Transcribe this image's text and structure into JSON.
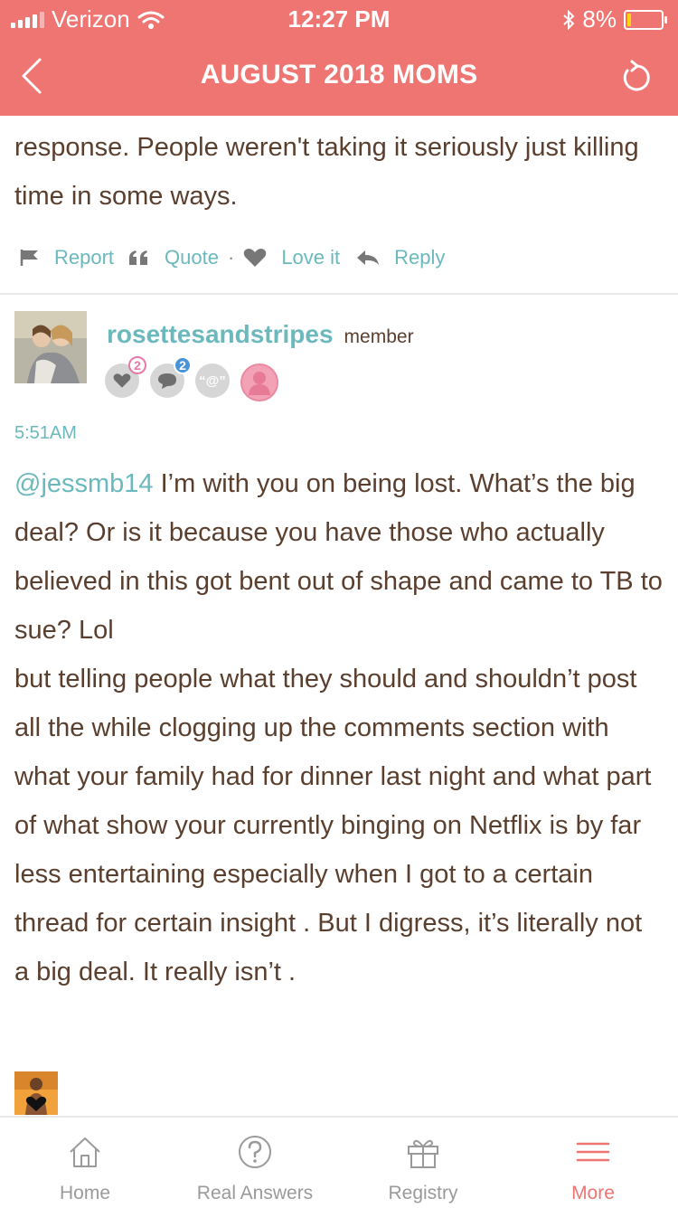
{
  "status_bar": {
    "carrier": "Verizon",
    "time": "12:27 PM",
    "battery": "8%"
  },
  "header": {
    "title": "AUGUST 2018 MOMS"
  },
  "previous_post": {
    "text": "response. People weren't taking it seriously just killing time in some ways.",
    "actions": {
      "report": "Report",
      "quote": "Quote",
      "separator": "·",
      "love": "Love it",
      "reply": "Reply"
    }
  },
  "post": {
    "username": "rosettesandstripes",
    "role": "member",
    "badges": {
      "hearts_count": "2",
      "comments_count": "2",
      "at_label": "“@”"
    },
    "time": "5:51AM",
    "mention": "@jessmb14",
    "body": " I’m with you on being lost. What’s the big deal? Or is it because you have those who actually believed in this got bent out of shape and came to TB to sue? Lol",
    "body2": "but telling people what they should and shouldn’t post all the while clogging up the comments section with what your family had for dinner last night and what part of what show your currently binging on Netflix is by far less entertaining especially when I got to a certain thread for certain insight . But I digress, it’s literally not a big deal. It really isn’t ."
  },
  "tab_bar": {
    "items": [
      {
        "label": "Home",
        "icon": "home-icon"
      },
      {
        "label": "Real Answers",
        "icon": "question-icon"
      },
      {
        "label": "Registry",
        "icon": "gift-icon"
      },
      {
        "label": "More",
        "icon": "menu-icon"
      }
    ],
    "active_color": "#ef7572",
    "inactive_color": "#9a9a9a"
  },
  "colors": {
    "header_bg": "#ef7572",
    "accent": "#6bb9bd",
    "text": "#5a3f2e"
  }
}
